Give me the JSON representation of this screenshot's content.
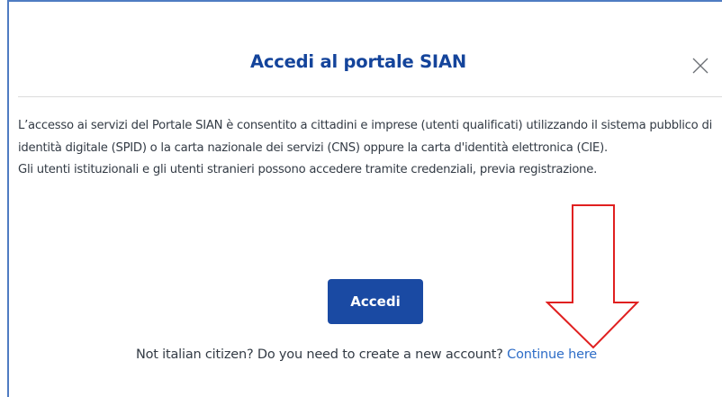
{
  "modal": {
    "title": "Accedi al portale SIAN",
    "close_icon": "close-icon",
    "paragraph_1": "L’accesso ai servizi del Portale SIAN è consentito a cittadini e imprese (utenti qualificati) utilizzando il sistema pubblico di identità digitale (SPID)  o la carta nazionale dei servizi (CNS) oppure la carta d'identità elettronica (CIE).",
    "paragraph_2": "Gli utenti istituzionali e gli utenti stranieri possono accedere tramite credenziali, previa registrazione.",
    "login_button_label": "Accedi",
    "footer_text": "Not italian citizen? Do you need to create a new account? ",
    "footer_link_label": "Continue here"
  },
  "colors": {
    "title": "#14449b",
    "button": "#1a4aa3",
    "link": "#2e6dc7",
    "frame_border": "#4f7cc2",
    "annotation_arrow": "#e02020"
  }
}
